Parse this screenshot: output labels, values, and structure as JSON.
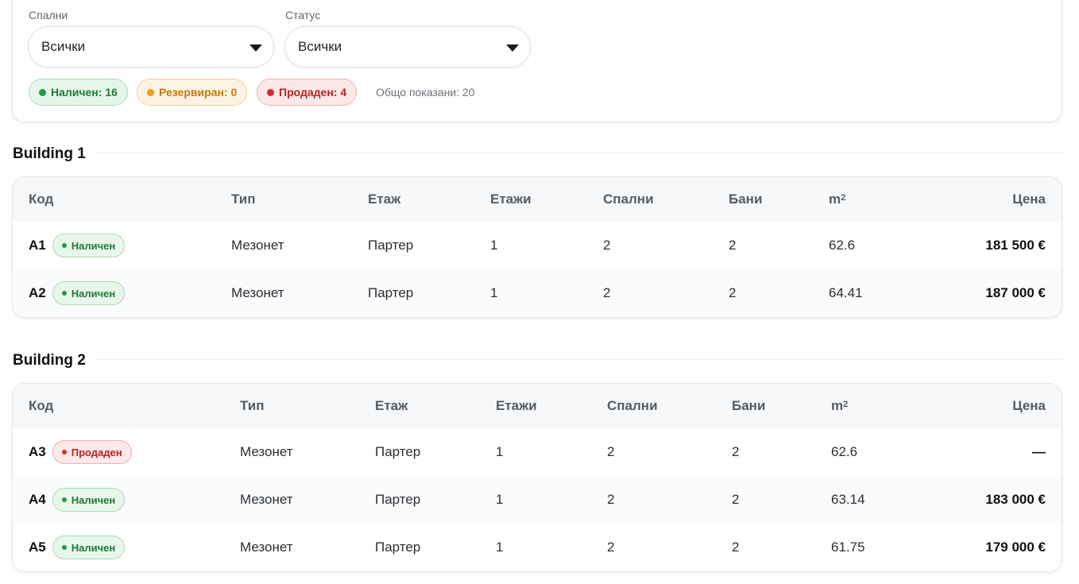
{
  "filters": {
    "bedrooms": {
      "label": "Спални",
      "value": "Всички"
    },
    "status": {
      "label": "Статус",
      "value": "Всички"
    },
    "chips": [
      {
        "label": "Наличен: 16",
        "color": "#1f9a45"
      },
      {
        "label": "Резервиран: 0",
        "color": "#ef9c17"
      },
      {
        "label": "Продаден: 4",
        "color": "#d92b2b"
      }
    ],
    "total": "Общо показани: 20"
  },
  "columns": [
    "Код",
    "Тип",
    "Етаж",
    "Етажи",
    "Спални",
    "Бани",
    "m",
    "Цена"
  ],
  "area_unit_sup": "2",
  "buildings": [
    {
      "title": "Building 1",
      "rows": [
        {
          "code": "A1",
          "status": "Наличен",
          "status_color": "green",
          "type": "Мезонет",
          "floor": "Партер",
          "floors": "1",
          "bedrooms": "2",
          "baths": "2",
          "area": "62.6",
          "price": "181 500 €"
        },
        {
          "code": "A2",
          "status": "Наличен",
          "status_color": "green",
          "type": "Мезонет",
          "floor": "Партер",
          "floors": "1",
          "bedrooms": "2",
          "baths": "2",
          "area": "64.41",
          "price": "187 000 €"
        }
      ]
    },
    {
      "title": "Building 2",
      "rows": [
        {
          "code": "A3",
          "status": "Продаден",
          "status_color": "red",
          "type": "Мезонет",
          "floor": "Партер",
          "floors": "1",
          "bedrooms": "2",
          "baths": "2",
          "area": "62.6",
          "price": "—"
        },
        {
          "code": "A4",
          "status": "Наличен",
          "status_color": "green",
          "type": "Мезонет",
          "floor": "Партер",
          "floors": "1",
          "bedrooms": "2",
          "baths": "2",
          "area": "63.14",
          "price": "183 000 €"
        },
        {
          "code": "A5",
          "status": "Наличен",
          "status_color": "green",
          "type": "Мезонет",
          "floor": "Партер",
          "floors": "1",
          "bedrooms": "2",
          "baths": "2",
          "area": "61.75",
          "price": "179 000 €"
        }
      ]
    }
  ]
}
